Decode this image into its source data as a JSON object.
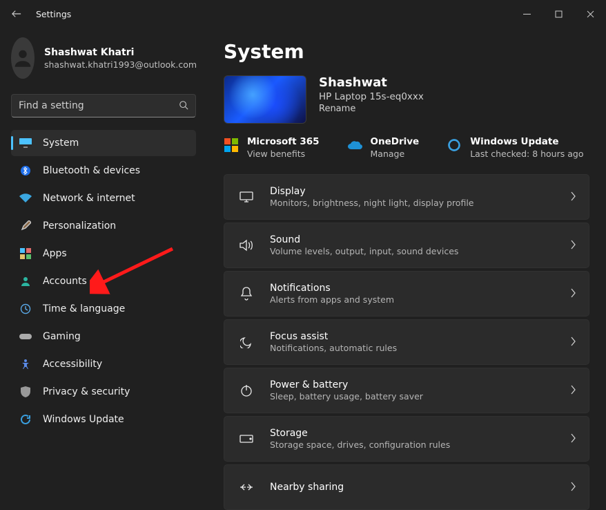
{
  "window": {
    "title": "Settings"
  },
  "profile": {
    "name": "Shashwat Khatri",
    "email": "shashwat.khatri1993@outlook.com"
  },
  "search": {
    "placeholder": "Find a setting"
  },
  "nav": [
    {
      "label": "System"
    },
    {
      "label": "Bluetooth & devices"
    },
    {
      "label": "Network & internet"
    },
    {
      "label": "Personalization"
    },
    {
      "label": "Apps"
    },
    {
      "label": "Accounts"
    },
    {
      "label": "Time & language"
    },
    {
      "label": "Gaming"
    },
    {
      "label": "Accessibility"
    },
    {
      "label": "Privacy & security"
    },
    {
      "label": "Windows Update"
    }
  ],
  "page": {
    "title": "System"
  },
  "device": {
    "name": "Shashwat",
    "model": "HP Laptop 15s-eq0xxx",
    "rename": "Rename"
  },
  "quick": {
    "m365": {
      "title": "Microsoft 365",
      "sub": "View benefits"
    },
    "onedrive": {
      "title": "OneDrive",
      "sub": "Manage"
    },
    "wu": {
      "title": "Windows Update",
      "sub": "Last checked: 8 hours ago"
    }
  },
  "cards": {
    "display": {
      "title": "Display",
      "desc": "Monitors, brightness, night light, display profile"
    },
    "sound": {
      "title": "Sound",
      "desc": "Volume levels, output, input, sound devices"
    },
    "notifications": {
      "title": "Notifications",
      "desc": "Alerts from apps and system"
    },
    "focus": {
      "title": "Focus assist",
      "desc": "Notifications, automatic rules"
    },
    "power": {
      "title": "Power & battery",
      "desc": "Sleep, battery usage, battery saver"
    },
    "storage": {
      "title": "Storage",
      "desc": "Storage space, drives, configuration rules"
    },
    "nearby": {
      "title": "Nearby sharing"
    }
  }
}
